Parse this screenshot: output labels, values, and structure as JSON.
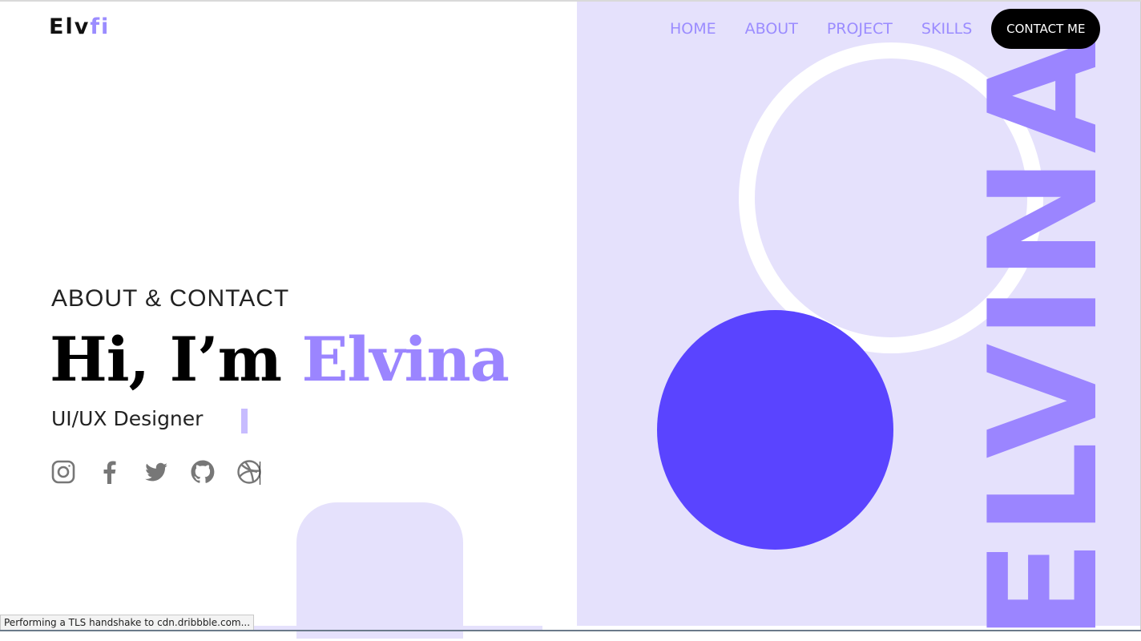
{
  "brand": {
    "logo_main": "Elv",
    "logo_accent": "fi"
  },
  "nav": {
    "items": [
      {
        "label": "HOME"
      },
      {
        "label": "ABOUT"
      },
      {
        "label": "PROJECT"
      },
      {
        "label": "SKILLS"
      }
    ],
    "cta_label": "CONTACT ME"
  },
  "hero": {
    "section_label": "ABOUT & CONTACT",
    "greeting": "Hi, I’m",
    "name": "Elvina",
    "role": "UI/UX Designer"
  },
  "decor": {
    "vertical_text": "ELVINA"
  },
  "socials": [
    {
      "icon": "instagram-icon"
    },
    {
      "icon": "facebook-icon"
    },
    {
      "icon": "twitter-icon"
    },
    {
      "icon": "github-icon"
    },
    {
      "icon": "dribbble-icon"
    }
  ],
  "status_bar": {
    "text": "Performing a TLS handshake to cdn.dribbble.com..."
  },
  "colors": {
    "accent": "#9b85ff",
    "panel_bg": "#e5e1fc",
    "solid_circle": "#5a44ff",
    "button_bg": "#000000"
  }
}
